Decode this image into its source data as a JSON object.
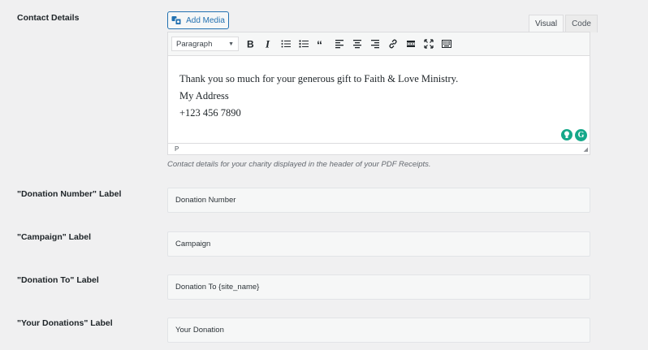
{
  "contact_details": {
    "label": "Contact Details",
    "add_media_label": "Add Media",
    "tabs": [
      "Visual",
      "Code"
    ],
    "toolbar": {
      "format": "Paragraph",
      "buttons": [
        "bold",
        "italic",
        "bullet-list",
        "numbered-list",
        "blockquote",
        "align-left",
        "align-center",
        "align-right",
        "link",
        "read-more",
        "fullscreen",
        "toolbar-toggle"
      ]
    },
    "content_lines": [
      "Thank you so much for your generous gift to Faith & Love Ministry.",
      "My Address",
      "+123 456 7890"
    ],
    "path_indicator": "P",
    "description": "Contact details for your charity displayed in the header of your PDF Receipts."
  },
  "fields": [
    {
      "label": "\"Donation Number\" Label",
      "value": "Donation Number"
    },
    {
      "label": "\"Campaign\" Label",
      "value": "Campaign"
    },
    {
      "label": "\"Donation To\" Label",
      "value": "Donation To {site_name}"
    },
    {
      "label": "\"Your Donations\" Label",
      "value": "Your Donation"
    }
  ]
}
